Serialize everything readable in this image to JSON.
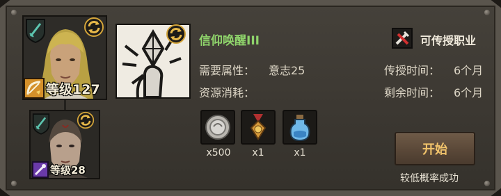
{
  "skill": {
    "title": "信仰唤醒III",
    "required_attr_label": "需要属性：",
    "required_attr_value": "意志25",
    "resource_label": "资源消耗：",
    "teach_time_label": "传授时间：",
    "teach_time_value": "6个月",
    "remaining_label": "剩余时间：",
    "remaining_value": "6个月",
    "tag_label": "可传授职业"
  },
  "teacher": {
    "level_label": "等级127"
  },
  "student": {
    "level_label": "等级28"
  },
  "costs": [
    {
      "name": "silver-coin",
      "qty": "x500"
    },
    {
      "name": "medal",
      "qty": "x1"
    },
    {
      "name": "potion",
      "qty": "x1"
    }
  ],
  "actions": {
    "start_label": "开始",
    "hint": "较低概率成功"
  },
  "colors": {
    "title": "#8fd46b",
    "button_text": "#f1c36b",
    "frame": "#5a554d"
  },
  "icons": [
    "sword-shield-icon",
    "refresh-icon",
    "bow-class-icon",
    "staff-class-icon",
    "crystal-hand-skill-icon",
    "crossed-tools-icon"
  ]
}
